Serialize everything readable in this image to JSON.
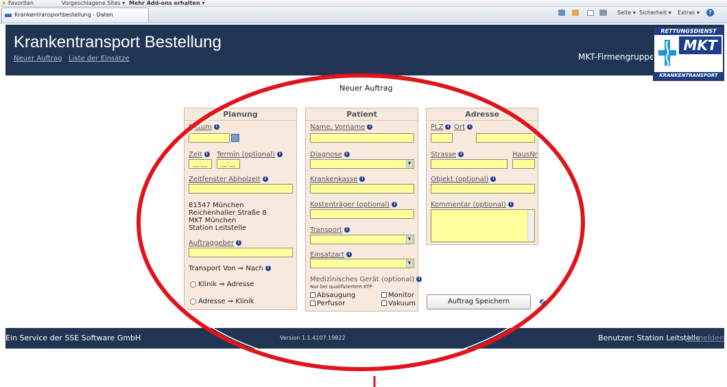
{
  "browser": {
    "favorites_label": "Favoriten",
    "suggested_sites": "Vorgeschlagene Sites ▾",
    "more_addons": "Mehr Add-ons erhalten ▾",
    "tab_title": "Krankentransportbestellung - Daten",
    "cmd_page": "Seite ▾",
    "cmd_security": "Sicherheit ▾",
    "cmd_extras": "Extras ▾"
  },
  "header": {
    "title": "Krankentransport Bestellung",
    "nav": [
      "Neuer Auftrag",
      "Liste der Einsätze"
    ],
    "company": "MKT-Firmengruppe",
    "logo": {
      "top": "RETTUNGSDIENST",
      "brand": "MKT",
      "bottom": "KRANKENTRANSPORT"
    }
  },
  "main": {
    "title": "Neuer Auftrag",
    "planung": {
      "heading": "Planung",
      "datum_label": "Datum",
      "zeit_label": "Zeit",
      "termin_label": "Termin (optional)",
      "time_placeholder": "__:__",
      "zeitfenster_label": "Zeitfenster Abholzeit",
      "address_lines": [
        "81547  München",
        "Reichenhaller Straße 8",
        "MKT München",
        "Station Leitstelle"
      ],
      "auftraggeber_label": "Auftraggeber",
      "transport_label": "Transport Von ⇒ Nach",
      "option_klinik_adresse": "Klinik ⇒ Adresse",
      "option_adresse_klinik": "Adresse ⇒ Klinik"
    },
    "patient": {
      "heading": "Patient",
      "name_label": "Name, Vorname",
      "diagnose_label": "Diagnose",
      "krankenkasse_label": "Krankenkasse",
      "kostentraeger_label": "Kostenträger (optional)",
      "transport_label": "Transport",
      "einsatzart_label": "Einsatzart",
      "geraet_label": "Medizinisches Gerät (optional)",
      "geraet_hint": "Nur bei qualifiziertem KTP",
      "devices": [
        "Absaugung",
        "Monitor",
        "Perfusor",
        "Vakuum"
      ]
    },
    "adresse": {
      "heading": "Adresse",
      "plz_label": "PLZ",
      "ort_label": "Ort",
      "strasse_label": "Strasse",
      "hausnr_label": "HausNr",
      "objekt_label": "Objekt (optional)",
      "kommentar_label": "Kommentar (optional)"
    },
    "save_button": "Auftrag Speichern"
  },
  "footer": {
    "service": "Ein Service der SSE Software GmbH",
    "version": "Version 1.1.4107.19822",
    "user": "Benutzer: Station Leitstelle",
    "logout": "Abmelden"
  },
  "colors": {
    "header_bg": "#203554",
    "panel_bg": "#f7e9de",
    "field_bg": "#ffff9b",
    "annotation": "#e0141c"
  }
}
